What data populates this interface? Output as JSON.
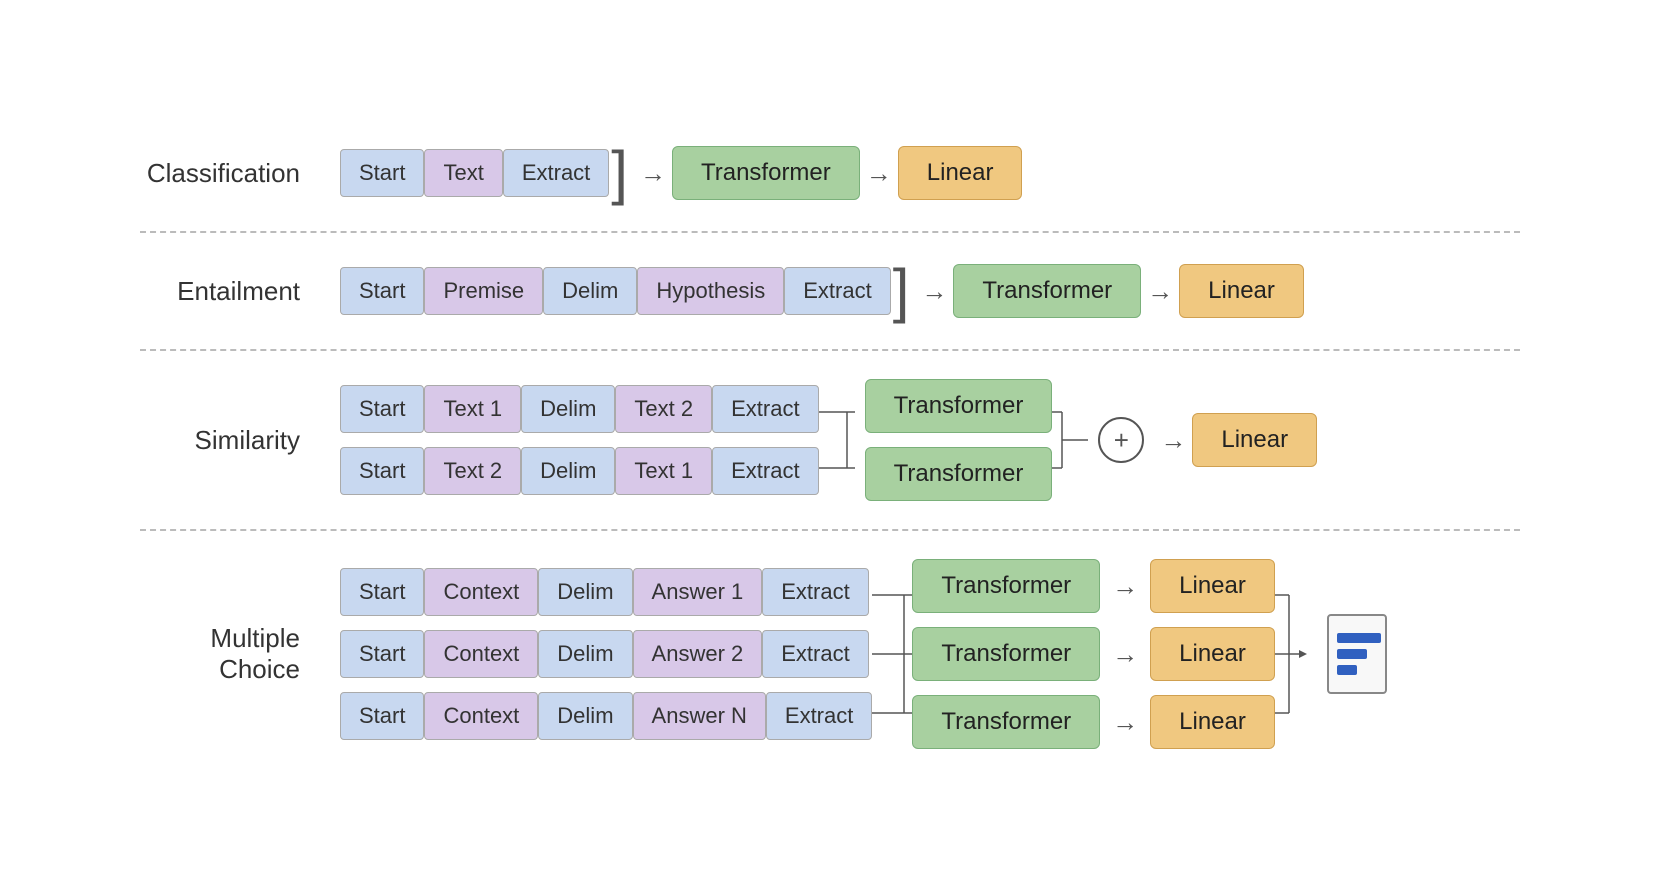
{
  "diagram": {
    "sections": [
      {
        "id": "classification",
        "label": "Classification",
        "rows": [
          {
            "tokens": [
              {
                "text": "Start",
                "color": "blue"
              },
              {
                "text": "Text",
                "color": "purple"
              },
              {
                "text": "Extract",
                "color": "blue"
              }
            ],
            "transformer": "Transformer",
            "linear": "Linear"
          }
        ]
      },
      {
        "id": "entailment",
        "label": "Entailment",
        "rows": [
          {
            "tokens": [
              {
                "text": "Start",
                "color": "blue"
              },
              {
                "text": "Premise",
                "color": "purple"
              },
              {
                "text": "Delim",
                "color": "blue"
              },
              {
                "text": "Hypothesis",
                "color": "purple"
              },
              {
                "text": "Extract",
                "color": "blue"
              }
            ],
            "transformer": "Transformer",
            "linear": "Linear"
          }
        ]
      },
      {
        "id": "similarity",
        "label": "Similarity",
        "row1": {
          "tokens": [
            {
              "text": "Start",
              "color": "blue"
            },
            {
              "text": "Text 1",
              "color": "purple"
            },
            {
              "text": "Delim",
              "color": "blue"
            },
            {
              "text": "Text 2",
              "color": "purple"
            },
            {
              "text": "Extract",
              "color": "blue"
            }
          ],
          "transformer": "Transformer"
        },
        "row2": {
          "tokens": [
            {
              "text": "Start",
              "color": "blue"
            },
            {
              "text": "Text 2",
              "color": "purple"
            },
            {
              "text": "Delim",
              "color": "blue"
            },
            {
              "text": "Text 1",
              "color": "purple"
            },
            {
              "text": "Extract",
              "color": "blue"
            }
          ],
          "transformer": "Transformer"
        },
        "plus": "+",
        "linear": "Linear"
      },
      {
        "id": "multiple-choice",
        "label": "Multiple Choice",
        "rows": [
          {
            "tokens": [
              {
                "text": "Start",
                "color": "blue"
              },
              {
                "text": "Context",
                "color": "purple"
              },
              {
                "text": "Delim",
                "color": "blue"
              },
              {
                "text": "Answer 1",
                "color": "purple"
              },
              {
                "text": "Extract",
                "color": "blue"
              }
            ],
            "transformer": "Transformer",
            "linear": "Linear"
          },
          {
            "tokens": [
              {
                "text": "Start",
                "color": "blue"
              },
              {
                "text": "Context",
                "color": "purple"
              },
              {
                "text": "Delim",
                "color": "blue"
              },
              {
                "text": "Answer 2",
                "color": "purple"
              },
              {
                "text": "Extract",
                "color": "blue"
              }
            ],
            "transformer": "Transformer",
            "linear": "Linear"
          },
          {
            "tokens": [
              {
                "text": "Start",
                "color": "blue"
              },
              {
                "text": "Context",
                "color": "purple"
              },
              {
                "text": "Delim",
                "color": "blue"
              },
              {
                "text": "Answer N",
                "color": "purple"
              },
              {
                "text": "Extract",
                "color": "blue"
              }
            ],
            "transformer": "Transformer",
            "linear": "Linear"
          }
        ],
        "bars": [
          60,
          40,
          25
        ]
      }
    ]
  }
}
